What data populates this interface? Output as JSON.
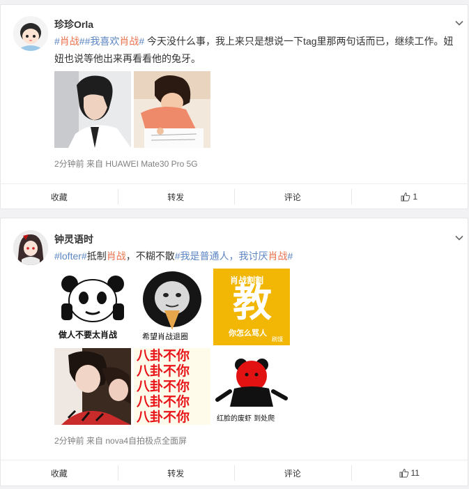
{
  "posts": [
    {
      "username": "珍珍Orla",
      "text_parts": {
        "hash1": "#",
        "tag1": "肖战",
        "hash2": "##我喜欢",
        "tag2": "肖战",
        "hash3": "#",
        "body": " 今天没什么事，我上来只是想说一下tag里那两句话而已，继续工作。妞妞也说等他出来再看看他的兔牙。"
      },
      "meta": "2分钟前  来自 HUAWEI Mate30 Pro 5G",
      "actions": {
        "favorite": "收藏",
        "repost": "转发",
        "comment": "评论",
        "likes": "1"
      }
    },
    {
      "username": "钟灵语时",
      "text_parts": {
        "link1": "#lofter#",
        "body1": "抵制",
        "tag1": "肖战",
        "body2": "，不糊不散",
        "link2": "#我是普通人，我讨厌",
        "tag2": "肖战",
        "link3": "#"
      },
      "memes": {
        "m1": "做人不要太肖战",
        "m2": "希望肖战退圈",
        "m3_top": "肖战割割",
        "m3_big": "教",
        "m3_bottom": "你怎么骂人",
        "m3_mark": "刷馒",
        "m5_line": "八卦不你",
        "m6": "红脸的废虾  到处爬"
      },
      "meta": "2分钟前  来自 nova4自拍极点全面屏",
      "actions": {
        "favorite": "收藏",
        "repost": "转发",
        "comment": "评论",
        "likes": "11"
      }
    }
  ],
  "icons": {
    "chevron": "chevron-down-icon",
    "like": "thumbs-up-icon"
  },
  "colors": {
    "tag": "#eb7350",
    "link": "#5d86c4",
    "meme_yellow": "#f2b705",
    "meme_red": "#e8161b"
  }
}
